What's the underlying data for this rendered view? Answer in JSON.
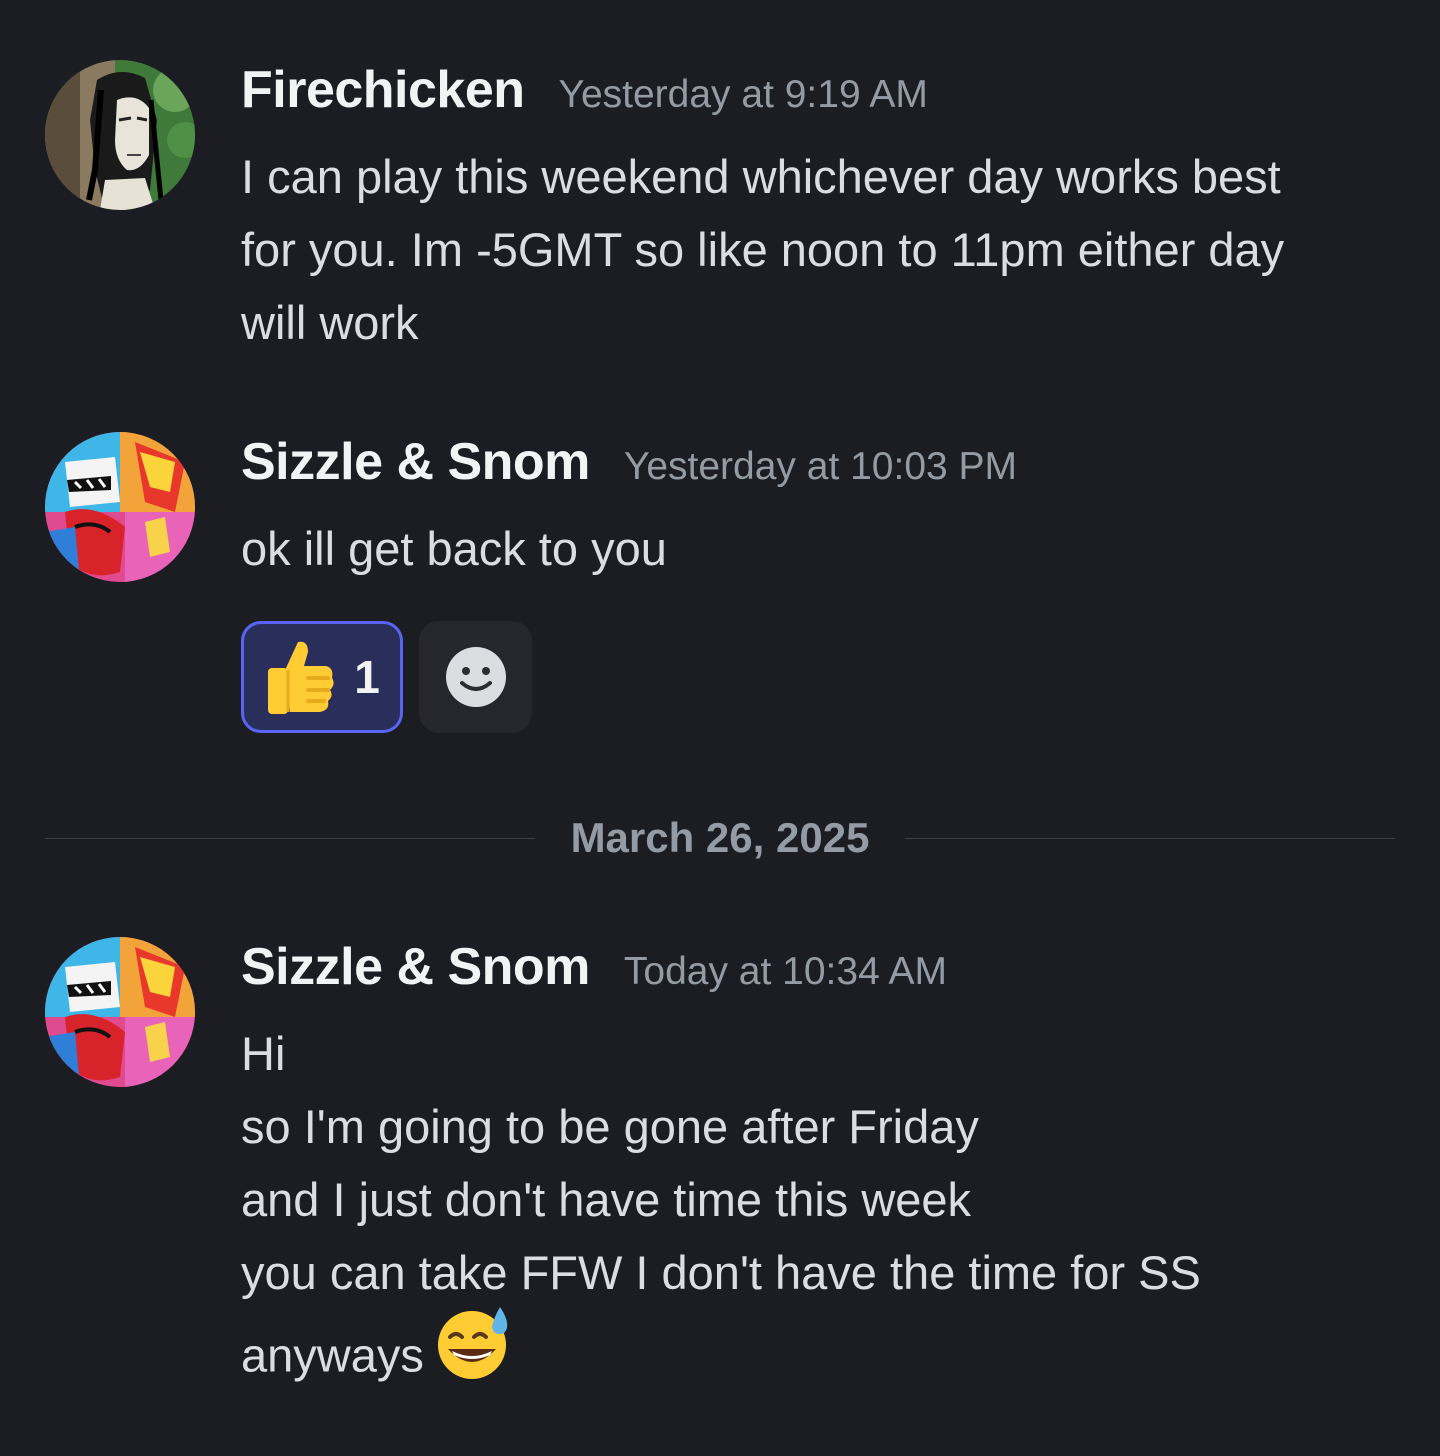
{
  "messages": [
    {
      "username": "Firechicken",
      "timestamp": "Yesterday at 9:19 AM",
      "lines": [
        "I can play this weekend whichever day works best",
        "for you. Im -5GMT so like noon to 11pm either day",
        "will work"
      ]
    },
    {
      "username": "Sizzle & Snom",
      "timestamp": "Yesterday at 10:03 PM",
      "lines": [
        "ok ill get back to you"
      ],
      "reactions": [
        {
          "emoji": "thumbs-up",
          "count": "1"
        }
      ],
      "add_reaction_icon": "smiley-icon"
    },
    {
      "username": "Sizzle & Snom",
      "timestamp": "Today at 10:34 AM",
      "lines": [
        "Hi",
        "so I'm going to be gone after Friday",
        "and I just don't have time this week",
        "you can take FFW I don't have the time for SS",
        "anyways"
      ],
      "trailing_emoji": "grinning-sweat"
    }
  ],
  "date_divider": "March 26, 2025",
  "colors": {
    "background": "#1c1d22",
    "username": "#f2f3f5",
    "timestamp": "#949ba4",
    "text": "#dbdee1",
    "reaction_active_bg": "#2a2e5a",
    "reaction_active_border": "#5865f2"
  }
}
